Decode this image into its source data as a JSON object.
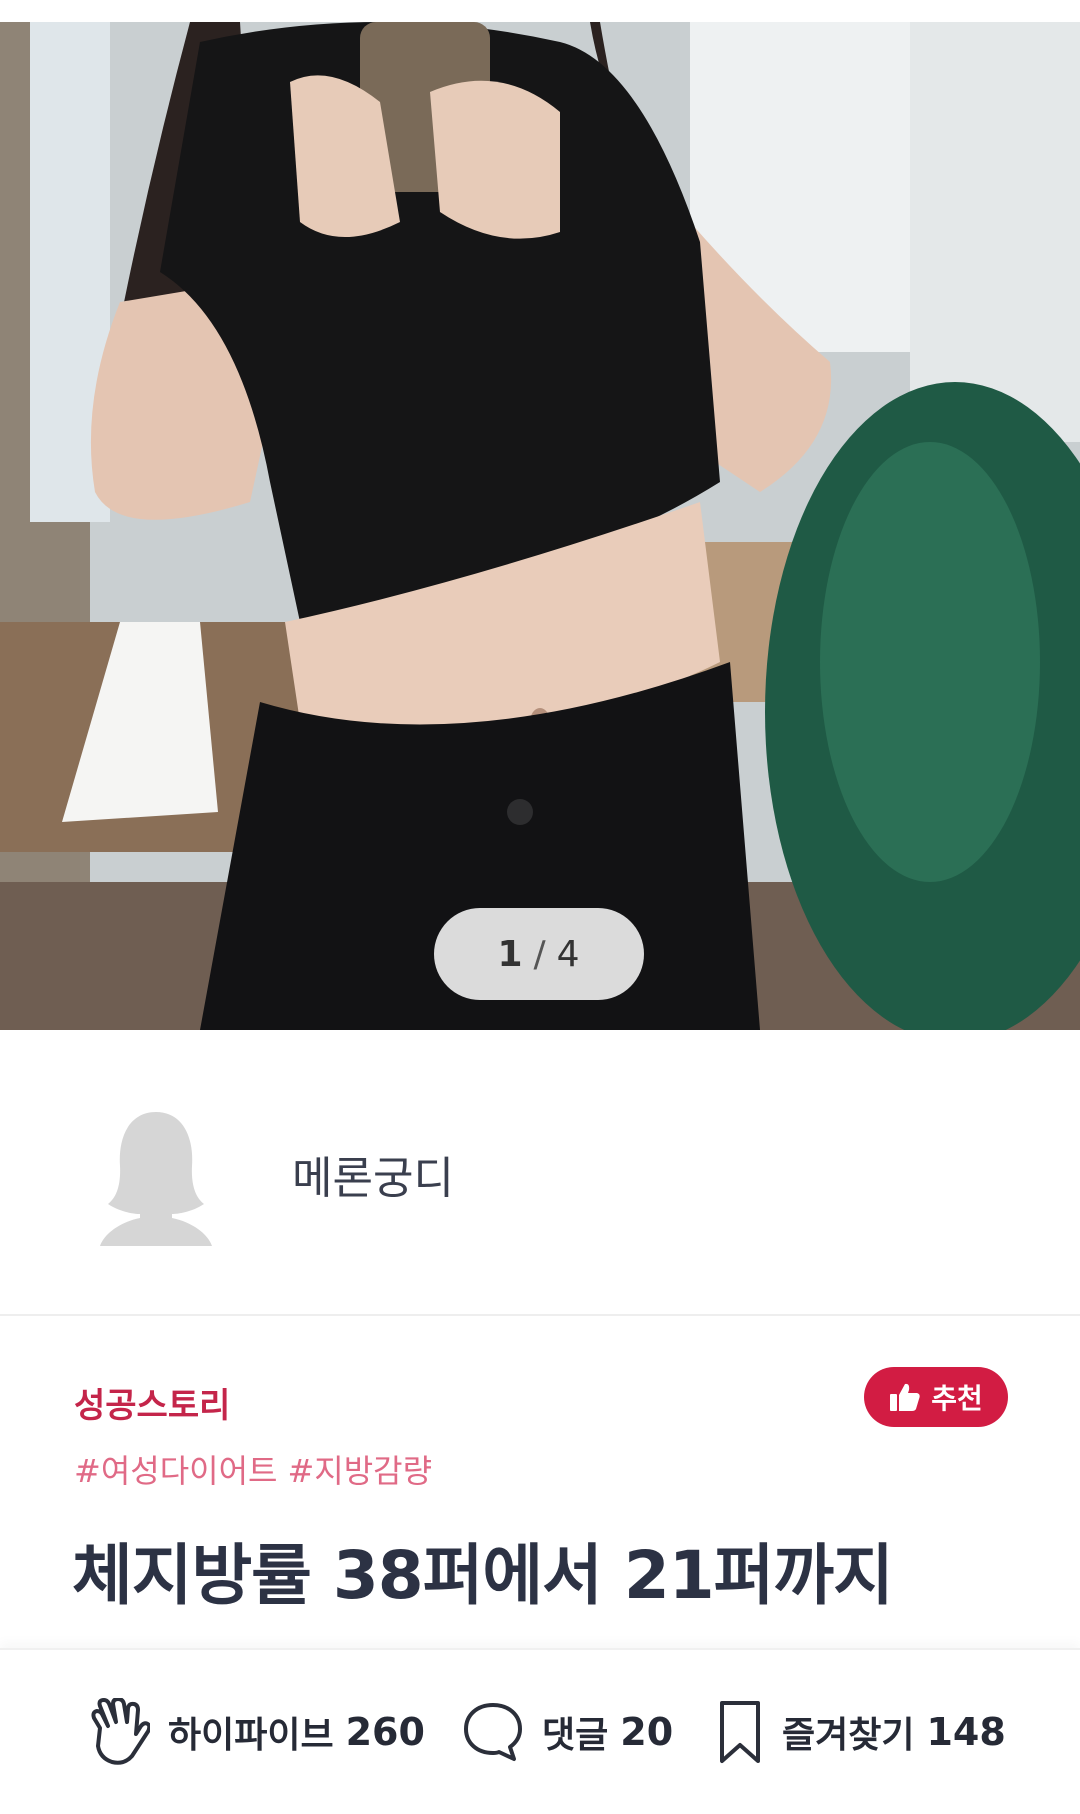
{
  "pager": {
    "current": "1",
    "separator": "/",
    "total": "4"
  },
  "author": {
    "name": "메론궁디"
  },
  "post": {
    "category": "성공스토리",
    "recommend_label": "추천",
    "tags": [
      "#여성다이어트",
      "#지방감량"
    ],
    "title": "체지방률 38퍼에서 21퍼까지"
  },
  "actions": {
    "highfive": {
      "label": "하이파이브",
      "count": "260",
      "icon": "hand-wave-icon"
    },
    "comment": {
      "label": "댓글",
      "count": "20",
      "icon": "speech-bubble-icon"
    },
    "bookmark": {
      "label": "즐겨찾기",
      "count": "148",
      "icon": "bookmark-icon"
    }
  },
  "colors": {
    "accent": "#d21c43",
    "category": "#c4254a",
    "tags": "#e06a86",
    "text": "#2c3244"
  }
}
